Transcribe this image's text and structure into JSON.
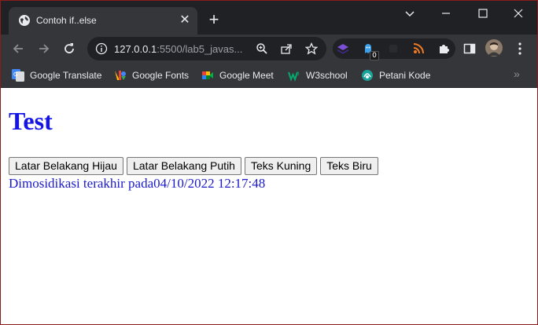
{
  "browser": {
    "tab": {
      "title": "Contoh if..else",
      "favicon": "globe-icon",
      "close_glyph": "✕"
    },
    "new_tab_glyph": "+",
    "window_controls": [
      "chevron-down-icon",
      "minimize-icon",
      "maximize-icon",
      "close-icon"
    ],
    "address": {
      "host": "127.0.0.1",
      "rest": ":5500/lab5_javas..."
    },
    "extensions_badge": "0",
    "bookmarks": [
      {
        "label": "Google Translate",
        "icon": "google-translate-icon"
      },
      {
        "label": "Google Fonts",
        "icon": "google-fonts-icon"
      },
      {
        "label": "Google Meet",
        "icon": "google-meet-icon"
      },
      {
        "label": "W3school",
        "icon": "w3school-icon"
      },
      {
        "label": "Petani Kode",
        "icon": "petani-kode-icon"
      }
    ],
    "bookmarks_more_glyph": "»"
  },
  "page": {
    "heading": "Test",
    "buttons": [
      {
        "label": "Latar Belakang Hijau"
      },
      {
        "label": "Latar Belakang Putih"
      },
      {
        "label": "Teks Kuning"
      },
      {
        "label": "Teks Biru"
      }
    ],
    "modified_text": "Dimosidikasi terakhir pada04/10/2022 12:17:48"
  },
  "colors": {
    "heading": "#1414e6",
    "modified": "#1a1acc",
    "chrome_dark": "#202124",
    "chrome_tab": "#35363a"
  }
}
